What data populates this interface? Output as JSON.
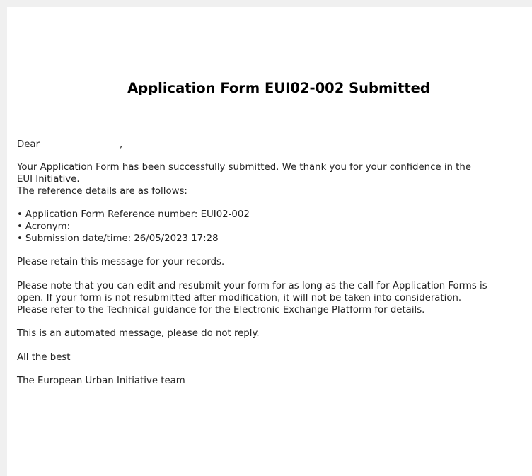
{
  "email": {
    "title": "Application Form EUI02-002 Submitted",
    "salutation": "Dear",
    "salutation_comma": ",",
    "paragraph1_line1": "Your Application Form has been successfully submitted. We thank you for your confidence in the",
    "paragraph1_line2": "EUI Initiative.",
    "paragraph1_line3": "The reference details are as follows:",
    "details": [
      "Application Form Reference number: EUI02-002",
      "Acronym:",
      "Submission date/time: 26/05/2023 17:28"
    ],
    "retain_note": "Please retain this message for your records.",
    "resubmit_line1": "Please note that you can edit and resubmit your form for as long as the call for Application Forms is",
    "resubmit_line2": "open. If your form is not resubmitted after modification, it will not be taken into consideration.",
    "resubmit_line3": "Please refer to the Technical guidance for the Electronic Exchange Platform for details.",
    "automated_note": "This is an automated message, please do not reply.",
    "closing": "All the best",
    "signature": "The European Urban Initiative team"
  }
}
